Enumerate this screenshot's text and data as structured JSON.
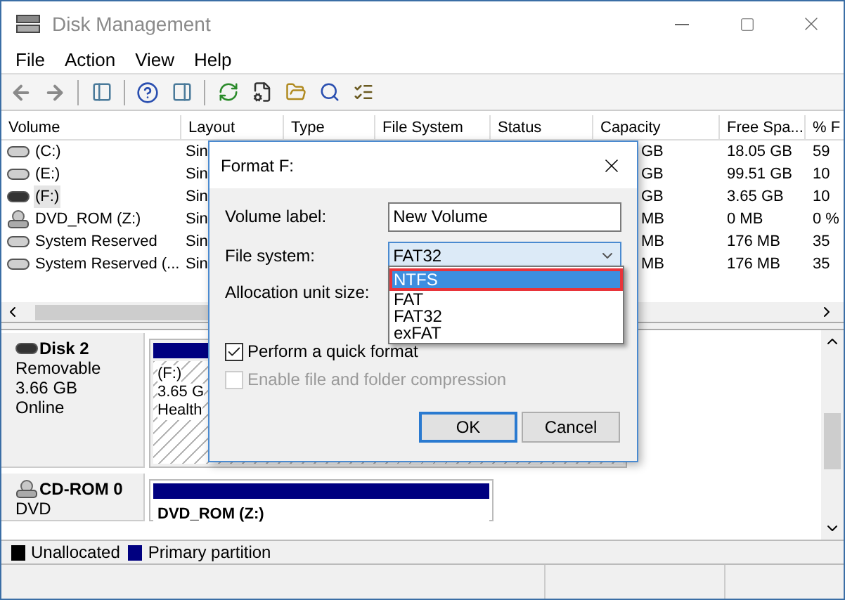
{
  "window": {
    "title": "Disk Management"
  },
  "menu": [
    "File",
    "Action",
    "View",
    "Help"
  ],
  "volume_table": {
    "columns": [
      "Volume",
      "Layout",
      "Type",
      "File System",
      "Status",
      "Capacity",
      "Free Spa...",
      "% F"
    ],
    "rows": [
      {
        "kind": "disk",
        "volume": "(C:)",
        "layout": "Sin",
        "capacity": "GB",
        "free_space": "18.05 GB",
        "percent_free": "59",
        "selected": false
      },
      {
        "kind": "disk",
        "volume": "(E:)",
        "layout": "Sin",
        "capacity": "GB",
        "free_space": "99.51 GB",
        "percent_free": "10",
        "selected": false
      },
      {
        "kind": "removable",
        "volume": "(F:)",
        "layout": "Sin",
        "capacity": "GB",
        "free_space": "3.65 GB",
        "percent_free": "10",
        "selected": true
      },
      {
        "kind": "dvd",
        "volume": "DVD_ROM (Z:)",
        "layout": "Sin",
        "capacity": "MB",
        "free_space": "0 MB",
        "percent_free": "0 %",
        "selected": false
      },
      {
        "kind": "disk",
        "volume": "System Reserved",
        "layout": "Sin",
        "capacity": "MB",
        "free_space": "176 MB",
        "percent_free": "35",
        "selected": false
      },
      {
        "kind": "disk",
        "volume": "System Reserved (...",
        "layout": "Sin",
        "capacity": "MB",
        "free_space": "176 MB",
        "percent_free": "35",
        "selected": false
      }
    ]
  },
  "disks": [
    {
      "kind": "removable",
      "name": "Disk 2",
      "lines": [
        "Removable",
        "3.66 GB",
        "Online"
      ],
      "partition": {
        "selected": true,
        "lines": [
          "(F:)",
          "3.65 G",
          "Health"
        ]
      }
    },
    {
      "kind": "dvd",
      "name": "CD-ROM 0",
      "lines": [
        "DVD"
      ],
      "partition": {
        "selected": false,
        "lines": [
          "DVD_ROM (Z:)"
        ]
      }
    }
  ],
  "legend": [
    {
      "label": "Unallocated",
      "color": "#000000"
    },
    {
      "label": "Primary partition",
      "color": "#000080"
    }
  ],
  "dialog": {
    "title": "Format F:",
    "volume_label": {
      "label": "Volume label:",
      "value": "New Volume"
    },
    "file_system": {
      "label": "File system:",
      "value": "FAT32",
      "options": [
        {
          "label": "NTFS",
          "highlighted": true
        },
        {
          "label": "FAT",
          "highlighted": false
        },
        {
          "label": "FAT32",
          "highlighted": false
        },
        {
          "label": "exFAT",
          "highlighted": false
        }
      ]
    },
    "allocation_label": "Allocation unit size:",
    "checkboxes": [
      {
        "label": "Perform a quick format",
        "checked": true,
        "disabled": false
      },
      {
        "label": "Enable file and folder compression",
        "checked": false,
        "disabled": true
      }
    ],
    "buttons": [
      {
        "label": "OK",
        "default": true
      },
      {
        "label": "Cancel",
        "default": false
      }
    ]
  }
}
